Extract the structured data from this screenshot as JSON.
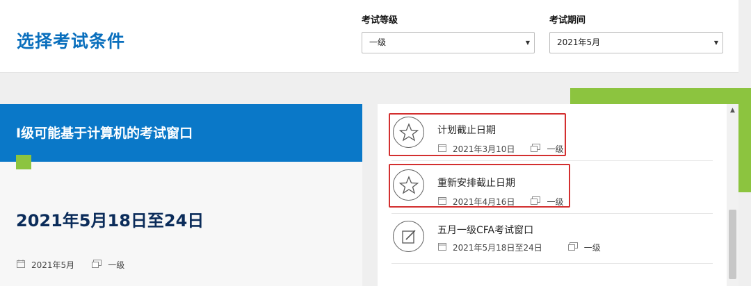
{
  "filter": {
    "title": "选择考试条件",
    "level_label": "考试等级",
    "level_value": "一级",
    "period_label": "考试期间",
    "period_value": "2021年5月"
  },
  "window": {
    "banner_title": "I级可能基于计算机的考试窗口",
    "date_range": "2021年5月18日至24日",
    "meta_date": "2021年5月",
    "meta_level": "一级"
  },
  "list": {
    "items": [
      {
        "title": "计划截止日期",
        "date": "2021年3月10日",
        "level": "一级",
        "icon": "star-icon"
      },
      {
        "title": "重新安排截止日期",
        "date": "2021年4月16日",
        "level": "一级",
        "icon": "star-icon"
      },
      {
        "title": "五月一级CFA考试窗口",
        "date": "2021年5月18日至24日",
        "level": "一级",
        "icon": "edit-icon"
      }
    ]
  },
  "colors": {
    "brand_blue": "#0a78c8",
    "title_blue": "#0a6fbd",
    "accent_green": "#8cc43f",
    "highlight_red": "#d32f2f",
    "date_navy": "#0b2c5a"
  }
}
